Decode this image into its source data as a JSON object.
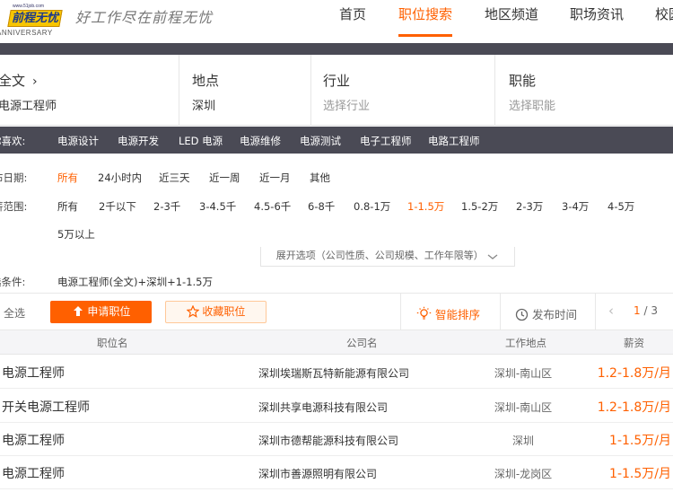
{
  "header": {
    "logo_url_text": "www.51job.com",
    "logo_badge": "前程无忧",
    "logo_anniversary": "ANNIVERSARY",
    "slogan": "好工作尽在前程无忧",
    "nav": [
      {
        "label": "首页",
        "active": false
      },
      {
        "label": "职位搜索",
        "active": true
      },
      {
        "label": "地区频道",
        "active": false
      },
      {
        "label": "职场资讯",
        "active": false
      },
      {
        "label": "校园",
        "active": false
      }
    ]
  },
  "search": {
    "fulltext": {
      "label": "全文",
      "value": "电源工程师"
    },
    "location": {
      "label": "地点",
      "value": "深圳"
    },
    "industry": {
      "label": "行业",
      "placeholder": "选择行业"
    },
    "function": {
      "label": "职能",
      "placeholder": "选择职能"
    }
  },
  "related": {
    "label": "你喜欢:",
    "keywords": [
      "电源设计",
      "电源开发",
      "LED 电源",
      "电源维修",
      "电源测试",
      "电子工程师",
      "电路工程师"
    ]
  },
  "filters": {
    "date": {
      "label": "布日期:",
      "options": [
        "所有",
        "24小时内",
        "近三天",
        "近一周",
        "近一月",
        "其他"
      ],
      "selected": "所有"
    },
    "salary": {
      "label": "薪范围:",
      "options": [
        "所有",
        "2千以下",
        "2-3千",
        "3-4.5千",
        "4.5-6千",
        "6-8千",
        "0.8-1万",
        "1-1.5万",
        "1.5-2万",
        "2-3万",
        "3-4万",
        "4-5万",
        "5万以上"
      ],
      "selected": "1-1.5万"
    },
    "expand_label": "展开选项（公司性质、公司规模、工作年限等）",
    "conditions_label": "选条件:",
    "conditions_value": "电源工程师(全文)+深圳+1-1.5万"
  },
  "toolbar": {
    "select_all": "全选",
    "apply_label": "申请职位",
    "fav_label": "收藏职位",
    "smart_sort": "智能排序",
    "publish_time": "发布时间",
    "page_current": "1",
    "page_total": "/ 3"
  },
  "table": {
    "headers": {
      "title": "职位名",
      "company": "公司名",
      "location": "工作地点",
      "salary": "薪资"
    },
    "rows": [
      {
        "title": "电源工程师",
        "company": "深圳埃瑞斯瓦特新能源有限公司",
        "location": "深圳-南山区",
        "salary": "1.2-1.8万/月"
      },
      {
        "title": "开关电源工程师",
        "company": "深圳共享电源科技有限公司",
        "location": "深圳-南山区",
        "salary": "1.2-1.8万/月"
      },
      {
        "title": "电源工程师",
        "company": "深圳市德帮能源科技有限公司",
        "location": "深圳",
        "salary": "1-1.5万/月"
      },
      {
        "title": "电源工程师",
        "company": "深圳市善源照明有限公司",
        "location": "深圳-龙岗区",
        "salary": "1-1.5万/月"
      }
    ]
  },
  "colors": {
    "accent": "#ff6000",
    "dark_bar": "#4a4a55",
    "logo_yellow": "#f7c500"
  }
}
